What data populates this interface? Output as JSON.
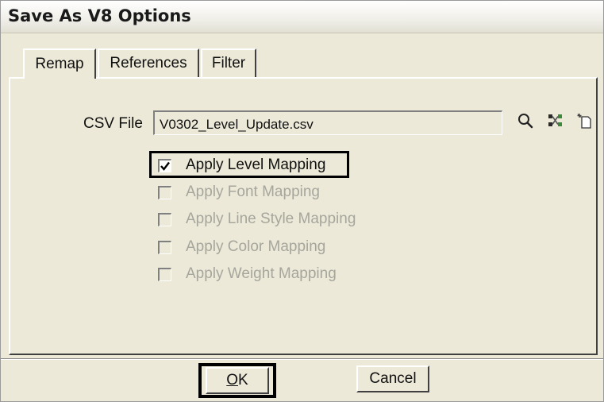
{
  "window": {
    "title": "Save As V8 Options"
  },
  "tabs": [
    {
      "label": "Remap",
      "active": true
    },
    {
      "label": "References",
      "active": false
    },
    {
      "label": "Filter",
      "active": false
    }
  ],
  "csv": {
    "label": "CSV File",
    "value": "V0302_Level_Update.csv"
  },
  "toolbar_icons": [
    "search-icon",
    "mapping-icon",
    "new-file-icon"
  ],
  "options": [
    {
      "label": "Apply Level Mapping",
      "checked": true,
      "enabled": true
    },
    {
      "label": "Apply Font Mapping",
      "checked": false,
      "enabled": false
    },
    {
      "label": "Apply Line Style Mapping",
      "checked": false,
      "enabled": false
    },
    {
      "label": "Apply Color Mapping",
      "checked": false,
      "enabled": false
    },
    {
      "label": "Apply Weight Mapping",
      "checked": false,
      "enabled": false
    }
  ],
  "buttons": {
    "ok_access": "O",
    "ok_rest": "K",
    "cancel": "Cancel"
  }
}
